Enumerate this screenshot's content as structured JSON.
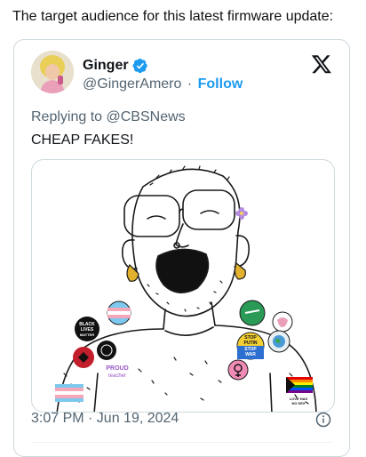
{
  "caption": "The target audience for this latest firmware update:",
  "tweet": {
    "display_name": "Ginger",
    "handle": "@GingerAmero",
    "separator": "·",
    "follow_label": "Follow",
    "replying_prefix": "Replying to",
    "replying_to": "@CBSNews",
    "text": "CHEAP FAKES!",
    "timestamp": "3:07 PM · Jun 19, 2024"
  },
  "icons": {
    "verified": "verified-badge-icon",
    "platform_logo": "x-logo-icon",
    "info": "info-icon"
  },
  "colors": {
    "accent": "#1d9bf0",
    "secondary_text": "#536471",
    "border": "#cfd9de"
  },
  "illustration": {
    "badges": {
      "blm_line1": "BLACK",
      "blm_line2": "LIVES",
      "blm_line3": "MATTER",
      "proud_line1": "PROUD",
      "proud_line2": "teacher",
      "stop_line1": "STOP",
      "stop_line2": "PUTIN",
      "stop_line3": "STOP",
      "stop_line4": "WAR",
      "love_line1": "LOVE HAS",
      "love_line2": "NO SEX"
    }
  }
}
